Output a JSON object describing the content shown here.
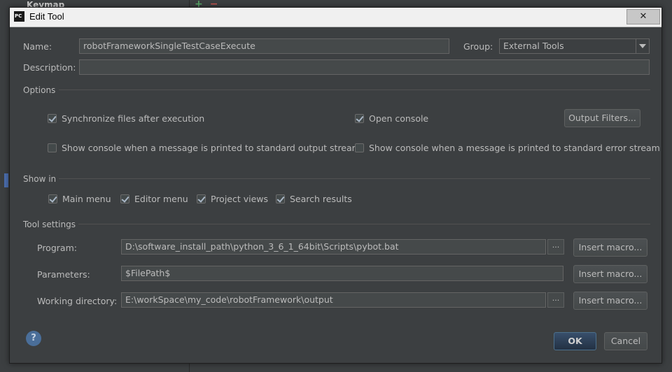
{
  "background": {
    "left_panel_title": "Keymap",
    "toolbar": {
      "add_icon": "+",
      "remove_icon": "−"
    }
  },
  "dialog": {
    "title": "Edit Tool",
    "app_icon": "PC",
    "close_glyph": "✕",
    "name": {
      "label": "Name:",
      "value": "robotFrameworkSingleTestCaseExecute"
    },
    "group": {
      "label": "Group:",
      "value": "External Tools"
    },
    "description": {
      "label": "Description:",
      "value": ""
    },
    "options": {
      "title": "Options",
      "sync_files": {
        "label": "Synchronize files after execution",
        "checked": true
      },
      "open_console": {
        "label": "Open console",
        "checked": true
      },
      "output_filters_button": "Output Filters...",
      "show_console_stdout": {
        "label": "Show console when a message is printed to standard output stream",
        "checked": false
      },
      "show_console_stderr": {
        "label": "Show console when a message is printed to standard error stream",
        "checked": false
      }
    },
    "show_in": {
      "title": "Show in",
      "main_menu": {
        "label": "Main menu",
        "checked": true
      },
      "editor_menu": {
        "label": "Editor menu",
        "checked": true
      },
      "project_views": {
        "label": "Project views",
        "checked": true
      },
      "search_results": {
        "label": "Search results",
        "checked": true
      }
    },
    "tool_settings": {
      "title": "Tool settings",
      "program": {
        "label": "Program:",
        "value": "D:\\software_install_path\\python_3_6_1_64bit\\Scripts\\pybot.bat"
      },
      "parameters": {
        "label": "Parameters:",
        "value": "$FilePath$"
      },
      "working_directory": {
        "label": "Working directory:",
        "value": "E:\\workSpace\\my_code\\robotFramework\\output"
      },
      "insert_macro": "Insert macro...",
      "browse": "..."
    },
    "help": "?",
    "ok": "OK",
    "cancel": "Cancel"
  },
  "colors": {
    "background": "#3c3f41",
    "field": "#45494a",
    "text": "#bbbbbb",
    "primary_button": "#2e4057",
    "help": "#4a6e99"
  }
}
